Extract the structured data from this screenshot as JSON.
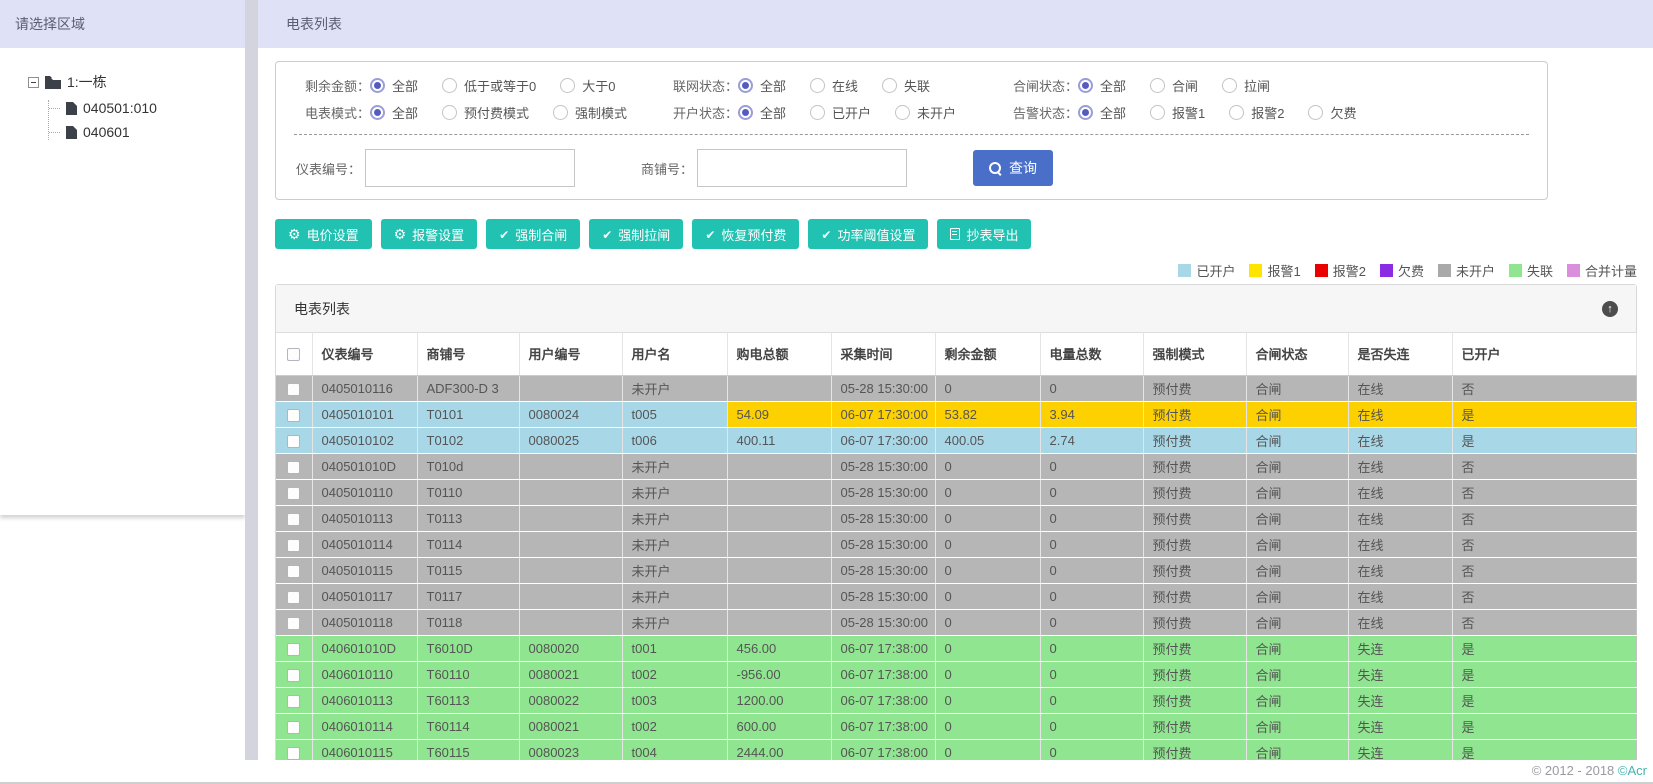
{
  "sidebar": {
    "title": "请选择区域",
    "tree": {
      "root": "1:一栋",
      "children": [
        "040501:010",
        "040601"
      ]
    }
  },
  "header": {
    "title": "电表列表"
  },
  "filters": {
    "rows": [
      [
        {
          "label": "剩余金额：",
          "options": [
            {
              "label": "全部",
              "selected": true
            },
            {
              "label": "低于或等于0",
              "selected": false
            },
            {
              "label": "大于0",
              "selected": false
            }
          ]
        },
        {
          "label": "联网状态：",
          "options": [
            {
              "label": "全部",
              "selected": true
            },
            {
              "label": "在线",
              "selected": false
            },
            {
              "label": "失联",
              "selected": false
            }
          ]
        },
        {
          "label": "合闸状态：",
          "options": [
            {
              "label": "全部",
              "selected": true
            },
            {
              "label": "合闸",
              "selected": false
            },
            {
              "label": "拉闸",
              "selected": false
            }
          ]
        }
      ],
      [
        {
          "label": "电表模式：",
          "options": [
            {
              "label": "全部",
              "selected": true
            },
            {
              "label": "预付费模式",
              "selected": false
            },
            {
              "label": "强制模式",
              "selected": false
            }
          ]
        },
        {
          "label": "开户状态：",
          "options": [
            {
              "label": "全部",
              "selected": true
            },
            {
              "label": "已开户",
              "selected": false
            },
            {
              "label": "未开户",
              "selected": false
            }
          ]
        },
        {
          "label": "告警状态：",
          "options": [
            {
              "label": "全部",
              "selected": true
            },
            {
              "label": "报警1",
              "selected": false
            },
            {
              "label": "报警2",
              "selected": false
            },
            {
              "label": "欠费",
              "selected": false
            }
          ]
        }
      ]
    ]
  },
  "search": {
    "fields": [
      {
        "label": "仪表编号：",
        "value": ""
      },
      {
        "label": "商铺号：",
        "value": ""
      }
    ],
    "button_label": "查询"
  },
  "actions": [
    {
      "label": "电价设置",
      "icon": "gear-icon"
    },
    {
      "label": "报警设置",
      "icon": "gear-icon"
    },
    {
      "label": "强制合闸",
      "icon": "check-icon"
    },
    {
      "label": "强制拉闸",
      "icon": "check-icon"
    },
    {
      "label": "恢复预付费",
      "icon": "check-icon"
    },
    {
      "label": "功率阈值设置",
      "icon": "check-icon"
    },
    {
      "label": "抄表导出",
      "icon": "file-icon"
    }
  ],
  "legend": [
    {
      "label": "已开户",
      "color": "#a8d7e8"
    },
    {
      "label": "报警1",
      "color": "#ffe400"
    },
    {
      "label": "报警2",
      "color": "#ea0000"
    },
    {
      "label": "欠费",
      "color": "#8b2be2"
    },
    {
      "label": "未开户",
      "color": "#a9a9a9"
    },
    {
      "label": "失联",
      "color": "#90e590"
    },
    {
      "label": "合并计量",
      "color": "#da8fdc"
    }
  ],
  "colors": {
    "header_bg": "#dfe1f7",
    "action_teal": "#21c2b2",
    "search_blue": "#4a6fc8",
    "row_unopened_gray": "#b6b6b6",
    "row_opened_blue": "#a8d7e8",
    "row_alarm_yellow": "#fdd000",
    "row_offline_green": "#90e590"
  },
  "table": {
    "title": "电表列表",
    "columns": [
      "仪表编号",
      "商铺号",
      "用户编号",
      "用户名",
      "购电总额",
      "采集时间",
      "剩余金额",
      "电量总数",
      "强制模式",
      "合闸状态",
      "是否失连",
      "已开户"
    ],
    "rows": [
      {
        "color": "gray",
        "cells": [
          "0405010116",
          "ADF300-D 3",
          "",
          "未开户",
          "",
          "05-28 15:30:00",
          "0",
          "0",
          "预付费",
          "合闸",
          "在线",
          "否"
        ]
      },
      {
        "color": "blue",
        "warn_from": 4,
        "cells": [
          "0405010101",
          "T0101",
          "0080024",
          "t005",
          "54.09",
          "06-07 17:30:00",
          "53.82",
          "3.94",
          "预付费",
          "合闸",
          "在线",
          "是"
        ]
      },
      {
        "color": "blue",
        "cells": [
          "0405010102",
          "T0102",
          "0080025",
          "t006",
          "400.11",
          "06-07 17:30:00",
          "400.05",
          "2.74",
          "预付费",
          "合闸",
          "在线",
          "是"
        ]
      },
      {
        "color": "gray",
        "cells": [
          "040501010D",
          "T010d",
          "",
          "未开户",
          "",
          "05-28 15:30:00",
          "0",
          "0",
          "预付费",
          "合闸",
          "在线",
          "否"
        ]
      },
      {
        "color": "gray",
        "cells": [
          "0405010110",
          "T0110",
          "",
          "未开户",
          "",
          "05-28 15:30:00",
          "0",
          "0",
          "预付费",
          "合闸",
          "在线",
          "否"
        ]
      },
      {
        "color": "gray",
        "cells": [
          "0405010113",
          "T0113",
          "",
          "未开户",
          "",
          "05-28 15:30:00",
          "0",
          "0",
          "预付费",
          "合闸",
          "在线",
          "否"
        ]
      },
      {
        "color": "gray",
        "cells": [
          "0405010114",
          "T0114",
          "",
          "未开户",
          "",
          "05-28 15:30:00",
          "0",
          "0",
          "预付费",
          "合闸",
          "在线",
          "否"
        ]
      },
      {
        "color": "gray",
        "cells": [
          "0405010115",
          "T0115",
          "",
          "未开户",
          "",
          "05-28 15:30:00",
          "0",
          "0",
          "预付费",
          "合闸",
          "在线",
          "否"
        ]
      },
      {
        "color": "gray",
        "cells": [
          "0405010117",
          "T0117",
          "",
          "未开户",
          "",
          "05-28 15:30:00",
          "0",
          "0",
          "预付费",
          "合闸",
          "在线",
          "否"
        ]
      },
      {
        "color": "gray",
        "cells": [
          "0405010118",
          "T0118",
          "",
          "未开户",
          "",
          "05-28 15:30:00",
          "0",
          "0",
          "预付费",
          "合闸",
          "在线",
          "否"
        ]
      },
      {
        "color": "green",
        "cells": [
          "040601010D",
          "T6010D",
          "0080020",
          "t001",
          "456.00",
          "06-07 17:38:00",
          "0",
          "0",
          "预付费",
          "合闸",
          "失连",
          "是"
        ]
      },
      {
        "color": "green",
        "cells": [
          "0406010110",
          "T60110",
          "0080021",
          "t002",
          "-956.00",
          "06-07 17:38:00",
          "0",
          "0",
          "预付费",
          "合闸",
          "失连",
          "是"
        ]
      },
      {
        "color": "green",
        "cells": [
          "0406010113",
          "T60113",
          "0080022",
          "t003",
          "1200.00",
          "06-07 17:38:00",
          "0",
          "0",
          "预付费",
          "合闸",
          "失连",
          "是"
        ]
      },
      {
        "color": "green",
        "cells": [
          "0406010114",
          "T60114",
          "0080021",
          "t002",
          "600.00",
          "06-07 17:38:00",
          "0",
          "0",
          "预付费",
          "合闸",
          "失连",
          "是"
        ]
      },
      {
        "color": "green",
        "cells": [
          "0406010115",
          "T60115",
          "0080023",
          "t004",
          "2444.00",
          "06-07 17:38:00",
          "0",
          "0",
          "预付费",
          "合闸",
          "失连",
          "是"
        ]
      }
    ]
  },
  "footer": {
    "copyright": "© 2012 - 2018 ",
    "link": "©Acr"
  }
}
